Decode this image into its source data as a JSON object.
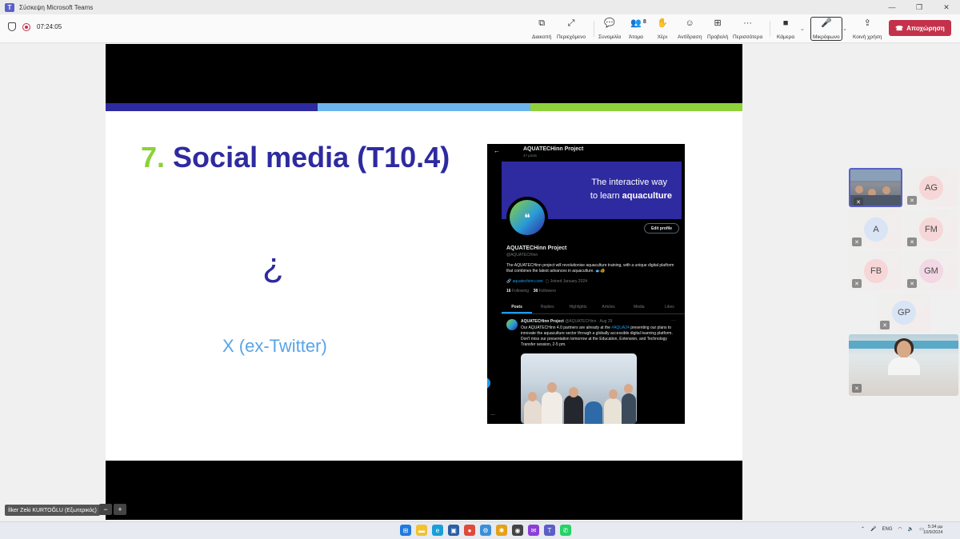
{
  "window": {
    "title": "Σύσκεψη Microsoft Teams"
  },
  "meeting": {
    "timer": "07:24:05",
    "toolbar": [
      {
        "id": "share",
        "label": "Διακοπή",
        "icon": "⧉"
      },
      {
        "id": "content",
        "label": "Περιεχόμενο",
        "icon": "⤢"
      },
      {
        "id": "chat",
        "label": "Συνομιλία",
        "icon": "💬"
      },
      {
        "id": "people",
        "label": "Άτομα",
        "icon": "👥",
        "count": "8"
      },
      {
        "id": "hand",
        "label": "Χέρι",
        "icon": "✋"
      },
      {
        "id": "react",
        "label": "Αντίδραση",
        "icon": "☺"
      },
      {
        "id": "view",
        "label": "Προβολή",
        "icon": "⊞"
      },
      {
        "id": "more",
        "label": "Περισσότερα",
        "icon": "···"
      },
      {
        "id": "camera",
        "label": "Κάμερα",
        "icon": "■"
      },
      {
        "id": "mic",
        "label": "Μικρόφωνο",
        "icon": "🎤"
      },
      {
        "id": "share_screen",
        "label": "Κοινή χρήση",
        "icon": "⇪"
      }
    ],
    "leave_label": "Αποχώρηση"
  },
  "slide": {
    "heading_number": "7.",
    "heading_text": "Social media (T10.4)",
    "question_mark": "¿",
    "subtitle": "X (ex-Twitter)",
    "bar_colors": [
      "#2e2aa0",
      "#6cb4ee",
      "#8fd23b"
    ]
  },
  "x_profile": {
    "header_name": "AQUATECHinn Project",
    "header_posts": "47 posts",
    "banner_line1": "The interactive way",
    "banner_line2_pre": "to learn ",
    "banner_line2_bold": "aquaculture",
    "edit_label": "Edit profile",
    "name": "AQUATECHinn Project",
    "handle": "@AQUATECHinn",
    "bio": "The AQUATECHinn project will revolutionise aquaculture training, with a unique digital platform that combines the latest advances in aquaculture. 🐟🐠",
    "link": "aquatechinn.com",
    "joined": "Joined January 2024",
    "following_count": "16",
    "following_label": "Following",
    "followers_count": "38",
    "followers_label": "Followers",
    "tabs": [
      "Posts",
      "Replies",
      "Highlights",
      "Articles",
      "Media",
      "Likes"
    ],
    "tweet": {
      "author": "AQUATECHinn Project",
      "meta": "@AQUATECHinn · Aug 29",
      "text_pre": "Our AQUATECHinn 4.0 partners are already at the ",
      "hashtag": "#AQUA24",
      "text_post": " presenting our plans to innovate the aquaculture sector through a globally accessible digital learning platform. Don't miss our presentation tomorrow at the Education, Extension, and Technology Transfer session, 2-5 pm."
    }
  },
  "participants": [
    {
      "id": "video1",
      "type": "video"
    },
    {
      "id": "AG",
      "initials": "AG",
      "color": "#f6d6d6"
    },
    {
      "id": "A",
      "initials": "A",
      "color": "#d9e4f5"
    },
    {
      "id": "FM",
      "initials": "FM",
      "color": "#f6d6d6"
    },
    {
      "id": "FB",
      "initials": "FB",
      "color": "#f6d6d6"
    },
    {
      "id": "GM",
      "initials": "GM",
      "color": "#f2d7e4"
    },
    {
      "id": "GP",
      "initials": "GP",
      "color": "#d9e4f5"
    },
    {
      "id": "video2",
      "type": "video"
    }
  ],
  "presenter_label": "İlker Zeki KURTOĞLU (Εξωτερικός)",
  "zoom_out": "−",
  "zoom_in": "+",
  "taskbar": {
    "language": "ENG",
    "time": "5:34 μμ",
    "date": "10/9/2024"
  }
}
